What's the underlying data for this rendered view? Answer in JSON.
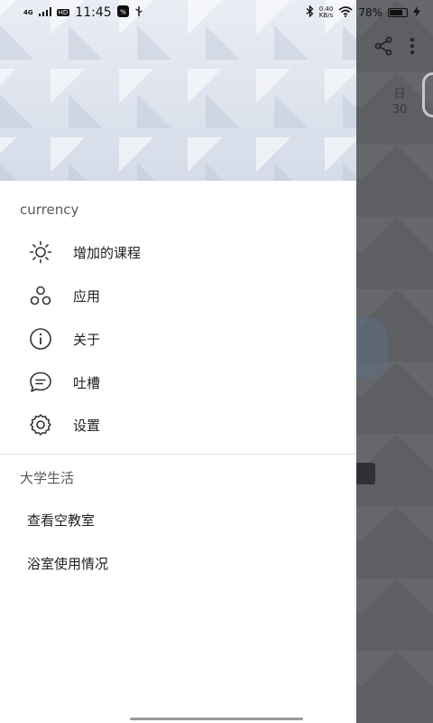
{
  "status_bar": {
    "network": "4G",
    "hd": "HD",
    "time": "11:45",
    "speed_value": "0.40",
    "speed_unit": "KB/s",
    "battery": "78%"
  },
  "background": {
    "day_label": "日",
    "day_number": "30"
  },
  "drawer": {
    "section1_title": "currency",
    "items": [
      {
        "label": "增加的课程",
        "icon": "sun-icon"
      },
      {
        "label": "应用",
        "icon": "apps-circles-icon"
      },
      {
        "label": "关于",
        "icon": "info-icon"
      },
      {
        "label": "吐槽",
        "icon": "chat-bubble-icon"
      },
      {
        "label": "设置",
        "icon": "gear-icon"
      }
    ],
    "section2_title": "大学生活",
    "links": [
      {
        "label": "查看空教室"
      },
      {
        "label": "浴室使用情况"
      }
    ]
  }
}
